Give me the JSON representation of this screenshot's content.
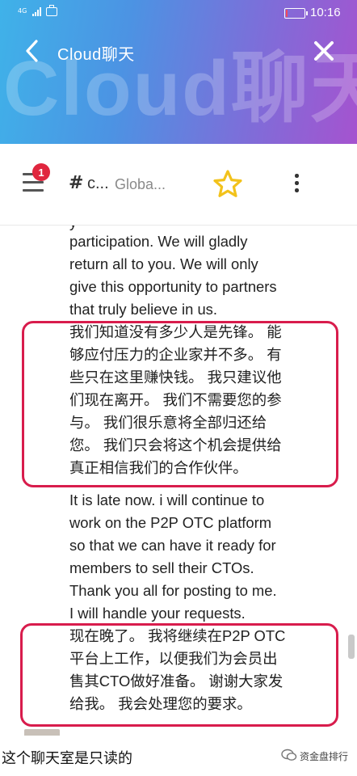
{
  "status_bar": {
    "network": "4G",
    "time": "10:16",
    "battery_level": 0.1
  },
  "header": {
    "title": "Cloud聊天",
    "watermark": "Cloud聊天"
  },
  "toolbar": {
    "badge_count": "1",
    "channel_hash": "#",
    "channel_name": "c...",
    "channel_sub": "Globa..."
  },
  "messages": [
    {
      "id": "msg1",
      "lines": [
        "participation. We will gladly",
        "return all to you. We will only",
        "give this opportunity to partners",
        "that truly believe in us."
      ]
    },
    {
      "id": "msg1_cn",
      "lines": [
        "我们知道没有多少人是先锋。 能",
        "够应付压力的企业家并不多。 有",
        "些只在这里赚快钱。 我只建议他",
        "们现在离开。 我们不需要您的参",
        "与。 我们很乐意将全部归还给",
        "您。 我们只会将这个机会提供给",
        "真正相信我们的合作伙伴。"
      ]
    },
    {
      "id": "msg2",
      "lines": [
        "It is late now. i will continue to",
        "work on the P2P OTC platform",
        "so that we can have it ready for",
        "members to sell their CTOs.",
        "Thank you all for posting to me.",
        "I will handle your requests."
      ]
    },
    {
      "id": "msg2_cn",
      "lines": [
        "现在晚了。 我将继续在P2P OTC",
        "平台上工作，以便我们为会员出",
        "售其CTO做好准备。 谢谢大家发",
        "给我。 我会处理您的要求。"
      ]
    }
  ],
  "footer": {
    "readonly_notice": "这个聊天室是只读的",
    "brand": "资金盘排行"
  },
  "colors": {
    "header_start": "#3fb2e9",
    "header_end": "#a553cf",
    "highlight": "#d81c4c",
    "badge": "#e0263e",
    "star": "#f2c21b"
  }
}
